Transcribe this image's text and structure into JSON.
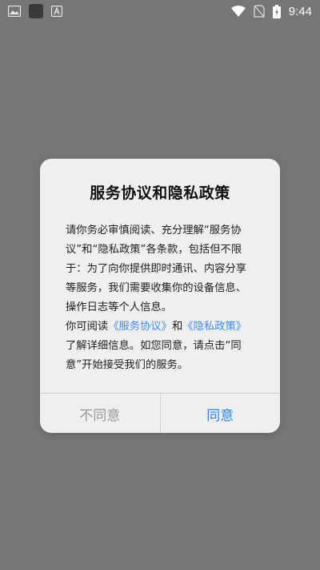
{
  "status_bar": {
    "time": "9:44",
    "icons_left": [
      "image-icon",
      "app-square-icon",
      "text-a-icon"
    ],
    "icons_right": [
      "wifi-icon",
      "no-sim-icon",
      "battery-icon"
    ]
  },
  "dialog": {
    "title": "服务协议和隐私政策",
    "paragraph1": "请你务必审慎阅读、充分理解“服务协议”和“隐私政策”各条款，包括但不限于：为了向你提供即时通讯、内容分享等服务，我们需要收集你的设备信息、操作日志等个人信息。",
    "paragraph2_prefix": "你可阅读",
    "link_service": "《服务协议》",
    "paragraph2_and": "和",
    "link_privacy": "《隐私政策》",
    "paragraph2_suffix": "了解详细信息。如您同意，请点击“同意”开始接受我们的服务。",
    "disagree_label": "不同意",
    "agree_label": "同意"
  },
  "colors": {
    "overlay": "#767676",
    "dialog_bg": "#efefef",
    "link": "#3d8ef0",
    "agree": "#2f86e8",
    "disagree": "#9a9a9a"
  }
}
